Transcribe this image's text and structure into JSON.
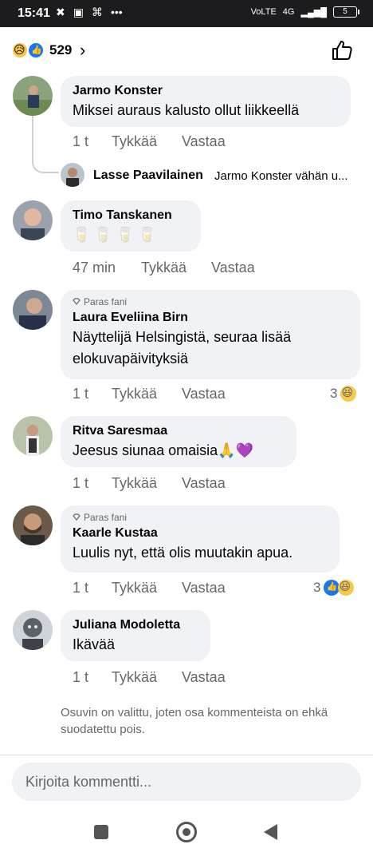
{
  "status_bar": {
    "time": "15:41",
    "network": "4G",
    "battery": "5"
  },
  "reactions_header": {
    "count": "529",
    "icons": [
      "sad-emoji",
      "like-emoji"
    ],
    "chevron": "›"
  },
  "comments": [
    {
      "name": "Jarmo Konster",
      "text": "Miksei auraus kalusto ollut liikkeellä",
      "time": "1 t",
      "like": "Tykkää",
      "reply": "Vastaa",
      "fan": ""
    },
    {
      "name": "Timo Tanskanen",
      "text": "🥛 🥛 🥛 🥛",
      "time": "47 min",
      "like": "Tykkää",
      "reply": "Vastaa",
      "fan": ""
    },
    {
      "name": "Laura Eveliina Birn",
      "text": "Näyttelijä Helsingistä, seuraa lisää elokuvapäivityksiä",
      "time": "1 t",
      "like": "Tykkää",
      "reply": "Vastaa",
      "fan": "Paras fani",
      "reaction_count": "3"
    },
    {
      "name": "Ritva Saresmaa",
      "text": "Jeesus siunaa omaisia🙏💜",
      "time": "1 t",
      "like": "Tykkää",
      "reply": "Vastaa",
      "fan": ""
    },
    {
      "name": "Kaarle Kustaa",
      "text": "Luulis nyt, että olis muutakin apua.",
      "time": "1 t",
      "like": "Tykkää",
      "reply": "Vastaa",
      "fan": "Paras fani",
      "reaction_count": "3"
    },
    {
      "name": "Juliana Modoletta",
      "text": "Ikävää",
      "time": "1 t",
      "like": "Tykkää",
      "reply": "Vastaa",
      "fan": ""
    }
  ],
  "reply": {
    "name": "Lasse Paavilainen",
    "text": "Jarmo Konster vähän u..."
  },
  "notice": "Osuvin on valittu, joten osa kommenteista on ehkä suodatettu pois.",
  "composer": {
    "placeholder": "Kirjoita kommentti..."
  }
}
